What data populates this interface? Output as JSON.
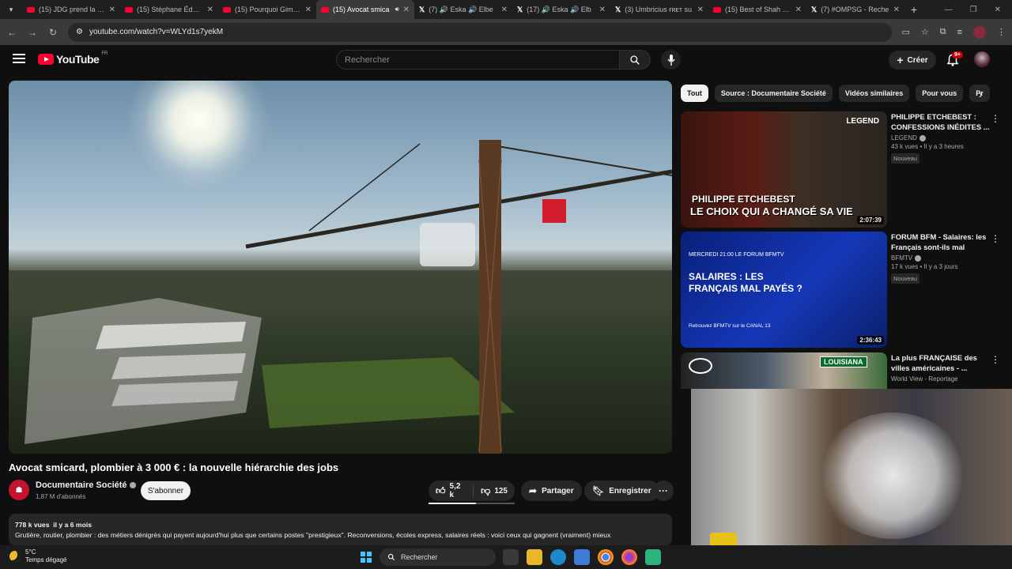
{
  "browser": {
    "tabs": [
      {
        "label": "(15) JDG prend la pa",
        "icon": "youtube-icon",
        "active": false
      },
      {
        "label": "(15) Stéphane Édoua",
        "icon": "youtube-icon",
        "active": false
      },
      {
        "label": "(15) Pourquoi Gims o",
        "icon": "youtube-icon",
        "active": false
      },
      {
        "label": "(15) Avocat smica",
        "icon": "youtube-icon",
        "active": true
      },
      {
        "label": "(7) 🔊 Eska 🔊 Elbe",
        "icon": "x-icon",
        "active": false
      },
      {
        "label": "(17) 🔊 Eska 🔊 Elb",
        "icon": "x-icon",
        "active": false
      },
      {
        "label": "(3) Umbricius ғʀᴇᴛ su",
        "icon": "x-icon",
        "active": false
      },
      {
        "label": "(15) Best of Shah Ru",
        "icon": "youtube-icon",
        "active": false
      },
      {
        "label": "(7) #OMPSG - Reche",
        "icon": "x-icon",
        "active": false
      }
    ],
    "url": "youtube.com/watch?v=WLYd1s7yekM"
  },
  "youtube": {
    "logo_text": "YouTube",
    "country": "FR",
    "search_placeholder": "Rechercher",
    "create_label": "Créer",
    "notif_count": "9+"
  },
  "video": {
    "title": "Avocat smicard, plombier à 3 000 € : la nouvelle hiérarchie des jobs",
    "channel": "Documentaire Société",
    "subscribers": "1,87 M d'abonnés",
    "subscribe_label": "S'abonner",
    "likes": "5,2 k",
    "dislikes": "125",
    "like_ratio": 0.55,
    "share_label": "Partager",
    "save_label": "Enregistrer",
    "views": "778 k vues",
    "age": "il y a 6 mois",
    "description": "Grutière, routier, plombier : des métiers dénigrés qui payent aujourd'hui plus que certains postes \"prestigieux\". Reconversions, écoles express, salaires réels : voici ceux qui gagnent (vraiment) mieux"
  },
  "chips": [
    "Tout",
    "Source : Documentaire Société",
    "Vidéos similaires",
    "Pour vous",
    "Pr"
  ],
  "recommendations": [
    {
      "title": "PHILIPPE ETCHEBEST : CONFESSIONS INÉDITES ...",
      "channel": "LEGEND",
      "meta": "43 k vues • Il y a 3 heures",
      "badge": "Nouveau",
      "duration": "2:07:39",
      "thumb_text_1": "PHILIPPE ETCHEBEST",
      "thumb_text_2": "LE CHOIX QUI A CHANGÉ SA VIE",
      "thumb_brand": "LEGEND"
    },
    {
      "title": "FORUM BFM - Salaires: les Français sont-ils mal payés?",
      "channel": "BFMTV",
      "meta": "17 k vues • Il y a 3 jours",
      "badge": "Nouveau",
      "duration": "2:36:43",
      "thumb_text_1": "MERCREDI 21:00 LE FORUM BFMTV",
      "thumb_text_2": "SALAIRES : LES FRANÇAIS MAL PAYÉS ?",
      "thumb_brand": "Retrouvez BFMTV sur le CANAL 13"
    },
    {
      "title": "La plus FRANÇAISE des villes américaines - ...",
      "channel": "World View - Reportage",
      "meta": "",
      "badge": "",
      "duration": "",
      "thumb_text_1": "LOUISIANA",
      "thumb_text_2": "",
      "thumb_brand": ""
    }
  ],
  "taskbar": {
    "temperature": "5°C",
    "weather": "Temps dégagé",
    "search_label": "Rechercher"
  }
}
